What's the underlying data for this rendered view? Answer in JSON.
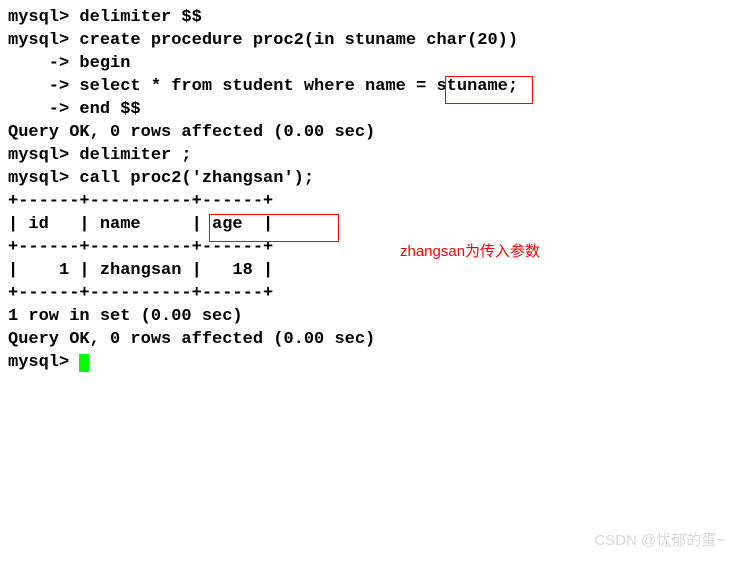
{
  "terminal": {
    "lines": [
      "mysql> delimiter $$",
      "mysql> create procedure proc2(in stuname char(20))",
      "    -> begin",
      "    -> select * from student where name = stuname;",
      "    -> end $$",
      "Query OK, 0 rows affected (0.00 sec)",
      "",
      "mysql> delimiter ;",
      "mysql> call proc2('zhangsan');",
      "+------+----------+------+",
      "| id   | name     | age  |",
      "+------+----------+------+",
      "|    1 | zhangsan |   18 |",
      "+------+----------+------+",
      "1 row in set (0.00 sec)",
      "",
      "Query OK, 0 rows affected (0.00 sec)",
      "",
      "mysql> "
    ],
    "prompt_last": "mysql> "
  },
  "highlight": {
    "box1_text": "stuname;",
    "box2_text": "('zhangsan');"
  },
  "annotation": {
    "text": "zhangsan为传入参数"
  },
  "watermark": {
    "text": "CSDN @忧郁的蛋~"
  }
}
